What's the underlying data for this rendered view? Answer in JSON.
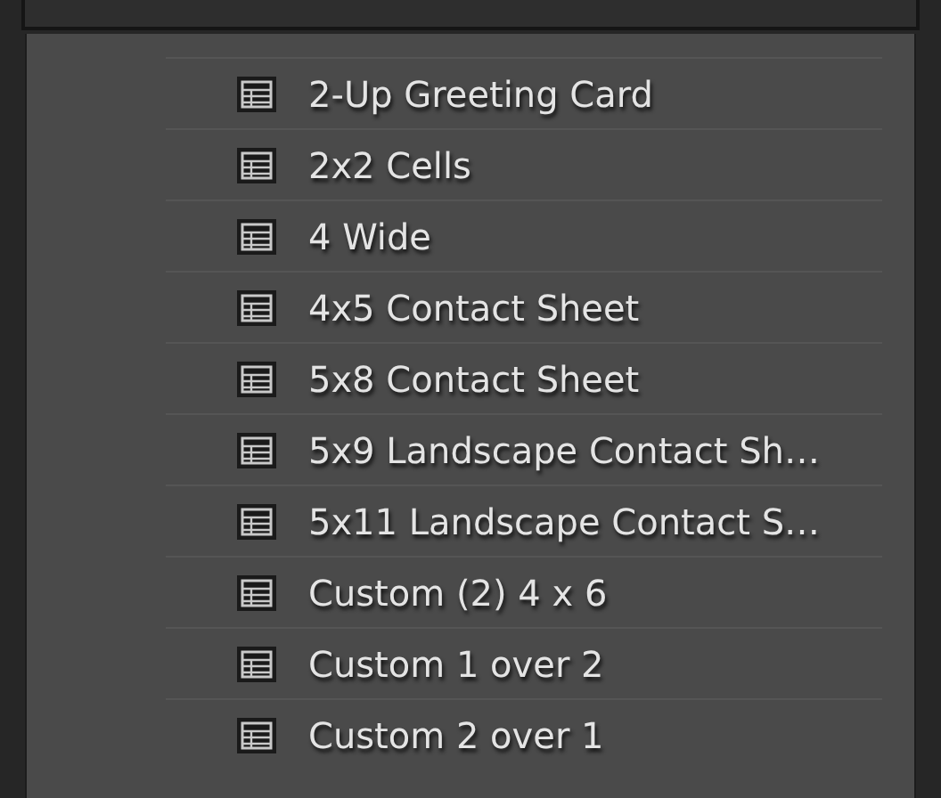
{
  "templates": [
    {
      "label": "2-Up Greeting Card"
    },
    {
      "label": "2x2 Cells"
    },
    {
      "label": "4 Wide"
    },
    {
      "label": "4x5 Contact Sheet"
    },
    {
      "label": "5x8 Contact Sheet"
    },
    {
      "label": "5x9 Landscape Contact Sh…"
    },
    {
      "label": "5x11 Landscape Contact S…"
    },
    {
      "label": "Custom (2) 4 x 6"
    },
    {
      "label": "Custom 1 over 2"
    },
    {
      "label": "Custom 2 over 1"
    }
  ]
}
